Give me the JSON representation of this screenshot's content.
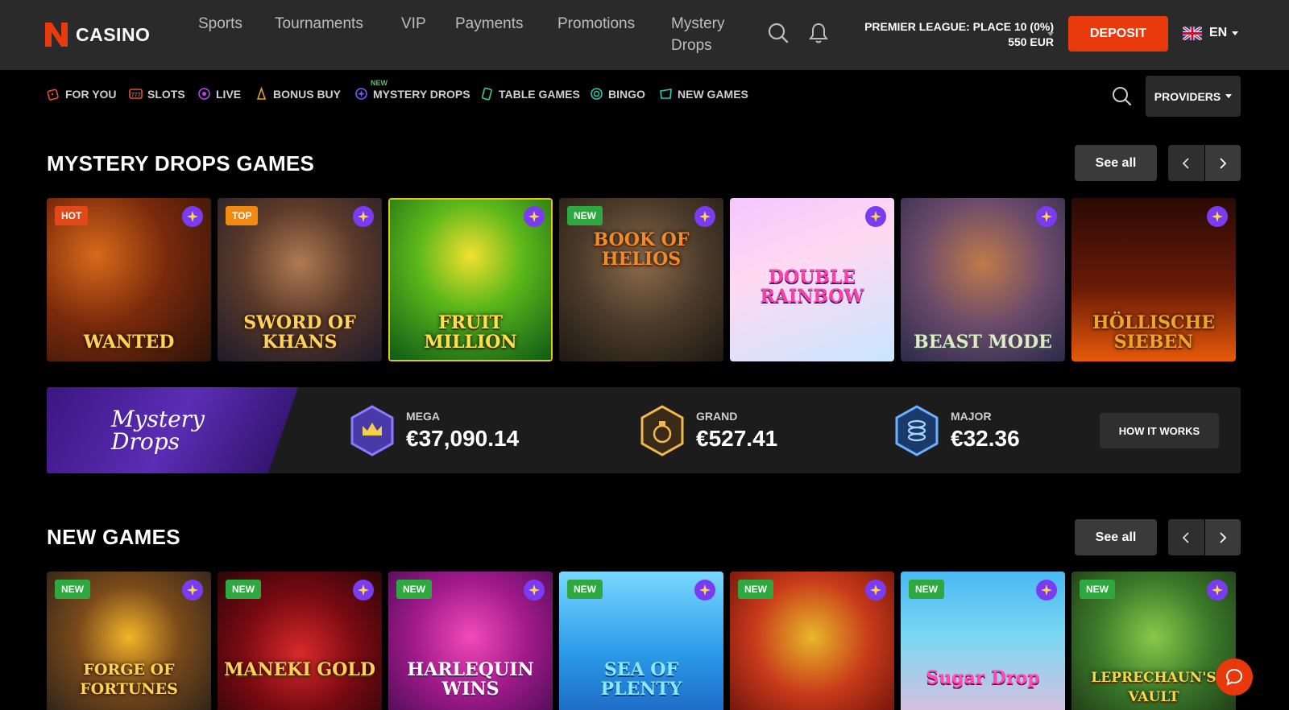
{
  "header": {
    "logo_text": "CASINO",
    "nav": [
      "Sports",
      "Tournaments",
      "VIP",
      "Payments",
      "Promotions",
      "Mystery Drops"
    ],
    "league_line1": "PREMIER LEAGUE: PLACE 10 (0%)",
    "league_line2": "550 EUR",
    "deposit_label": "DEPOSIT",
    "language": "EN"
  },
  "categories": {
    "items": [
      "FOR YOU",
      "SLOTS",
      "LIVE",
      "BONUS BUY",
      "MYSTERY DROPS",
      "TABLE GAMES",
      "BINGO",
      "NEW GAMES"
    ],
    "new_tag": "NEW",
    "providers_label": "PROVIDERS"
  },
  "mystery_section": {
    "title": "MYSTERY DROPS GAMES",
    "see_all": "See all",
    "games": [
      {
        "name": "WANTED",
        "badge": "HOT"
      },
      {
        "name": "SWORD OF KHANS",
        "badge": "TOP"
      },
      {
        "name": "FRUIT MILLION",
        "badge": ""
      },
      {
        "name": "BOOK OF HELIOS",
        "badge": "NEW"
      },
      {
        "name": "DOUBLE RAINBOW",
        "badge": ""
      },
      {
        "name": "BEAST MODE",
        "badge": ""
      },
      {
        "name": "HÖLLISCHE SIEBEN",
        "badge": ""
      }
    ]
  },
  "jackpot": {
    "banner_title": "Mystery Drops",
    "tiers": [
      {
        "label": "MEGA",
        "amount": "€37,090.14"
      },
      {
        "label": "GRAND",
        "amount": "€527.41"
      },
      {
        "label": "MAJOR",
        "amount": "€32.36"
      }
    ],
    "how_it_works": "HOW IT WORKS"
  },
  "new_section": {
    "title": "NEW GAMES",
    "see_all": "See all",
    "games": [
      {
        "name": "FORGE OF FORTUNES",
        "badge": "NEW"
      },
      {
        "name": "MANEKI GOLD",
        "badge": "NEW"
      },
      {
        "name": "HARLEQUIN WINS",
        "badge": "NEW"
      },
      {
        "name": "SEA OF PLENTY",
        "badge": "NEW"
      },
      {
        "name": "",
        "badge": "NEW"
      },
      {
        "name": "Sugar Drop",
        "badge": "NEW"
      },
      {
        "name": "LEPRECHAUN'S VAULT",
        "badge": "NEW"
      }
    ]
  },
  "colors": {
    "accent": "#e83a0c",
    "new_badge": "#2ea83f",
    "hot_badge": "#e04a1a",
    "top_badge": "#f08a12",
    "drop_star": "#7a3cf0"
  }
}
